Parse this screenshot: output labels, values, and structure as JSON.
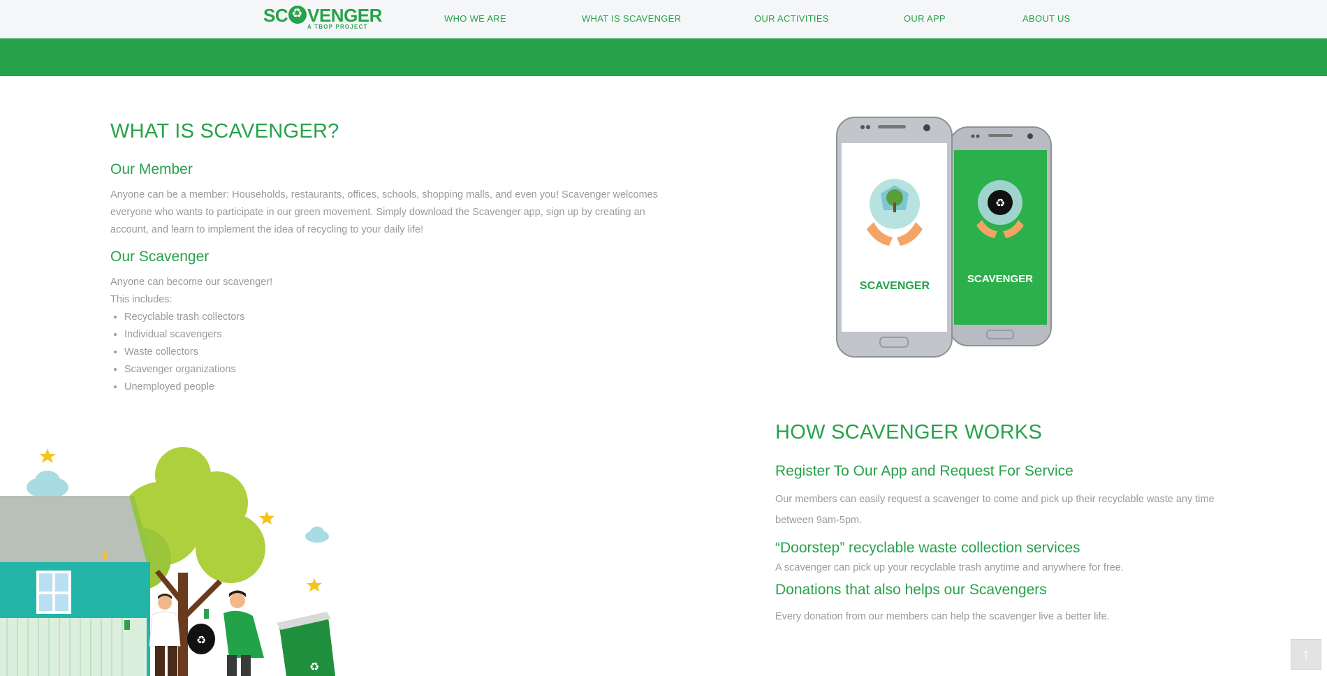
{
  "header": {
    "logo_text": "SC●VENGER",
    "logo_tagline": "A TBOP PROJECT",
    "nav": [
      "WHO WE ARE",
      "WHAT IS SCAVENGER",
      "OUR ACTIVITIES",
      "OUR APP",
      "ABOUT US"
    ]
  },
  "what_is": {
    "title": "WHAT IS SCAVENGER?",
    "member_heading": "Our Member",
    "member_text": "Anyone can be a member: Households, restaurants, offices, schools, shopping malls, and even you! Scavenger welcomes everyone who wants to participate in our green movement. Simply download the Scavenger app, sign up by creating an account, and learn to implement the idea of recycling to your daily life!",
    "scavenger_heading": "Our Scavenger",
    "scavenger_intro_1": "Anyone can become our scavenger!",
    "scavenger_intro_2": "This includes:",
    "scavenger_list": [
      "Recyclable trash collectors",
      "Individual scavengers",
      "Waste collectors",
      "Scavenger organizations",
      "Unemployed people"
    ]
  },
  "phones": {
    "left_label": "SCAVENGER",
    "right_label": "SCAVENGER"
  },
  "how_works": {
    "title": "HOW SCAVENGER WORKS",
    "items": [
      {
        "heading": "Register To Our App and Request For Service",
        "text": "Our members can easily request a scavenger to come and pick up their recyclable waste any time between 9am-5pm."
      },
      {
        "heading": "“Doorstep” recyclable waste collection services",
        "text": "A scavenger can pick up your recyclable trash anytime and anywhere for free."
      },
      {
        "heading": "Donations that also helps our Scavengers",
        "text": "Every donation from our members can help the scavenger live a better life."
      }
    ]
  },
  "back_to_top_icon": "arrow-up-icon",
  "colors": {
    "brand_green": "#26a24a",
    "header_bg": "#f5f6f7",
    "body_text": "#9a9a9a"
  }
}
